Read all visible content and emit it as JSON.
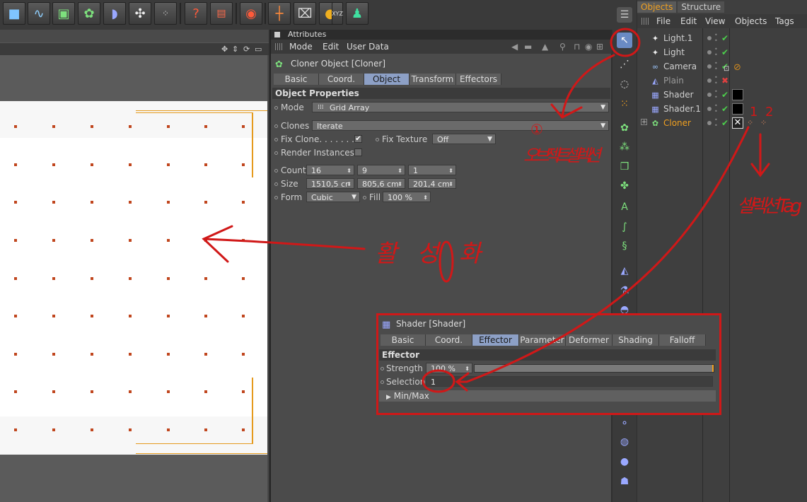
{
  "toolbar": {
    "icons": [
      "cube-icon",
      "spline-pen-icon",
      "nurbs-icon",
      "array-icon",
      "deformer-icon",
      "scene-icon",
      "particle-icon",
      "help-cursor-icon",
      "timeline-icon",
      "render-globe-icon",
      "axis-icon",
      "coordinate-icon",
      "lock-icon",
      "xyz-icon",
      "figure-icon"
    ],
    "xyz_label": "XYZ"
  },
  "attributes": {
    "title": "Attributes",
    "menu": [
      "Mode",
      "Edit",
      "User Data"
    ],
    "object_header": "Cloner Object [Cloner]",
    "tabs": [
      "Basic",
      "Coord.",
      "Object",
      "Transform",
      "Effectors"
    ],
    "active_tab": "Object",
    "section": "Object Properties",
    "mode": {
      "label": "Mode",
      "value": "Grid Array"
    },
    "clones": {
      "label": "Clones",
      "value": "Iterate"
    },
    "fix_clone": {
      "label": "Fix Clone. . . . . . . .",
      "checked": true
    },
    "fix_texture": {
      "label": "Fix Texture",
      "value": "Off"
    },
    "render_instances": {
      "label": "Render Instances",
      "checked": false
    },
    "count": {
      "label": "Count",
      "values": [
        "16",
        "9",
        "1"
      ]
    },
    "size": {
      "label": "Size",
      "values": [
        "1510,5 cr",
        "805,6 cm",
        "201,4 cm"
      ]
    },
    "form": {
      "label": "Form",
      "value": "Cubic"
    },
    "fill": {
      "label": "Fill",
      "value": "100 %"
    }
  },
  "shader_panel": {
    "header": "Shader [Shader]",
    "tabs": [
      "Basic",
      "Coord.",
      "Effector",
      "Parameter",
      "Deformer",
      "Shading",
      "Falloff"
    ],
    "active_tab": "Effector",
    "section": "Effector",
    "strength": {
      "label": "Strength",
      "value": "100 %",
      "fraction": 1.0
    },
    "selection": {
      "label": "Selection",
      "value": "1"
    },
    "minmax": "Min/Max"
  },
  "objects_panel": {
    "tabs": [
      "Objects",
      "Structure"
    ],
    "active_tab": "Objects",
    "menu": [
      "File",
      "Edit",
      "View",
      "Objects",
      "Tags"
    ],
    "rows": [
      {
        "name": "Light.1",
        "icon": "light-icon",
        "status": "✔"
      },
      {
        "name": "Light",
        "icon": "light-icon",
        "status": "✔"
      },
      {
        "name": "Camera",
        "icon": "camera-icon",
        "status": "✔"
      },
      {
        "name": "Plain",
        "icon": "plain-effector-icon",
        "status": "✖"
      },
      {
        "name": "Shader",
        "icon": "shader-effector-icon",
        "status": "✔"
      },
      {
        "name": "Shader.1",
        "icon": "shader-effector-icon",
        "status": "✔"
      },
      {
        "name": "Cloner",
        "icon": "cloner-icon",
        "status": "✔"
      }
    ]
  },
  "annotations": {
    "n1": "1",
    "n2": "2",
    "circled": "①",
    "korean_object_select": "오브젝트 셀렉션",
    "korean_activate": "활성화",
    "korean_selection_tag": "셀렉션 Tag"
  },
  "colors": {
    "accent": "#f0a020",
    "active_tab": "#8da0c6",
    "annotation_red": "#d01818",
    "clone_dot": "#c0461e"
  }
}
